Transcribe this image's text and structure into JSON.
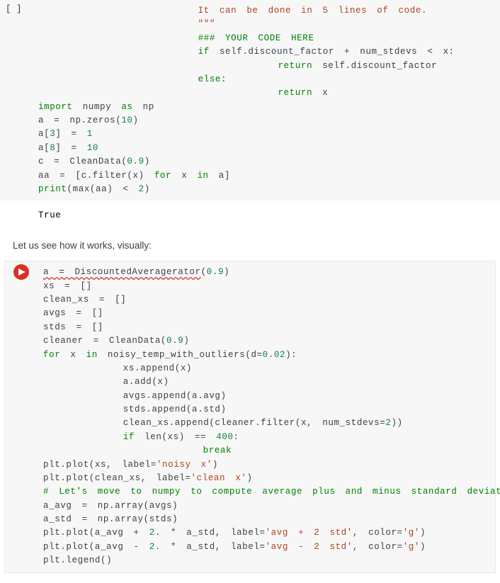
{
  "cell1": {
    "gutter": "[ ]",
    "code_html": "                <span class='tok-str'>It can be done in 5 lines of code.</span>\n                <span class='tok-str'>\"\"\"</span>\n                <span class='tok-cmt'>### YOUR CODE HERE</span>\n                <span class='tok-kw'>if</span> self.discount_factor + num_stdevs &lt; x:\n                        <span class='tok-kw'>return</span> self.discount_factor\n                <span class='tok-kw'>else</span>:\n                        <span class='tok-kw'>return</span> x\n<span class='tok-kw'>import</span> numpy <span class='tok-kw'>as</span> np\na = np.zeros(<span class='tok-num'>10</span>)\na[<span class='tok-num'>3</span>] = <span class='tok-num'>1</span>\na[<span class='tok-num'>8</span>] = <span class='tok-num'>10</span>\nc = CleanData(<span class='tok-num'>0.9</span>)\naa = [c.filter(x) <span class='tok-kw'>for</span> x <span class='tok-kw'>in</span> a]\n<span class='tok-kw'>print</span>(max(aa) &lt; <span class='tok-num'>2</span>)"
  },
  "output1": "True",
  "prose1": "Let us see how it works, visually:",
  "cell2": {
    "code_html": "<span class='err-underline'>a = DiscountedAveragerator</span>(<span class='tok-num'>0.9</span>)\nxs = []\nclean_xs = []\navgs = []\nstds = []\ncleaner = CleanData(<span class='tok-num'>0.9</span>)\n<span class='tok-kw'>for</span> x <span class='tok-kw'>in</span> noisy_temp_with_outliers(d=<span class='tok-num'>0.02</span>):\n        xs.append(x)\n        a.add(x)\n        avgs.append(a.avg)\n        stds.append(a.std)\n        clean_xs.append(cleaner.filter(x, num_stdevs=<span class='tok-num'>2</span>))\n        <span class='tok-kw'>if</span> len(xs) == <span class='tok-num'>400</span>:\n                <span class='tok-kw'>break</span>\nplt.plot(xs, label=<span class='tok-str'>'noisy x'</span>)\nplt.plot(clean_xs, label=<span class='tok-str'>'clean x'</span>)\n<span class='tok-cmt'># Let's move to numpy to compute average plus and minus standard deviation.</span>\na_avg = np.array(avgs)\na_std = np.array(stds)\nplt.plot(a_avg + <span class='tok-num'>2.</span> * a_std, label=<span class='tok-str'>'avg + 2 std'</span>, color=<span class='tok-str'>'g'</span>)\nplt.plot(a_avg - <span class='tok-num'>2.</span> * a_std, label=<span class='tok-str'>'avg - 2 std'</span>, color=<span class='tok-str'>'g'</span>)\nplt.legend()"
  }
}
